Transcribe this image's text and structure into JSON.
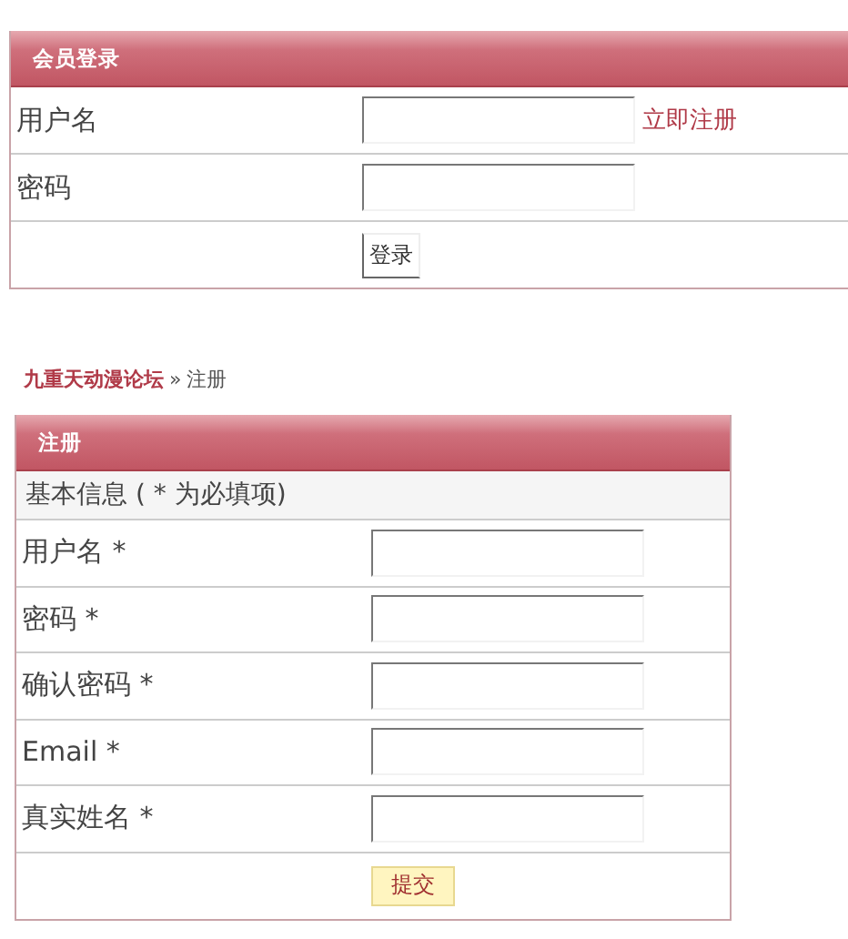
{
  "login_panel": {
    "title": "会员登录",
    "rows": [
      {
        "label": "用户名",
        "link": "立即注册"
      },
      {
        "label": "密码"
      }
    ],
    "button": {
      "label": "登录",
      "kind": "plain"
    }
  },
  "register_breadcrumb": {
    "link": "九重天动漫论坛",
    "separator": "»",
    "current": "注册"
  },
  "register_panel": {
    "title": "注册",
    "section": "基本信息 ( * 为必填项)",
    "rows": [
      {
        "label": "用户名 *"
      },
      {
        "label": "密码 *"
      },
      {
        "label": "确认密码 *"
      },
      {
        "label": "Email *"
      },
      {
        "label": "真实姓名 *"
      }
    ],
    "button": {
      "label": "提交",
      "kind": "highlight"
    }
  }
}
